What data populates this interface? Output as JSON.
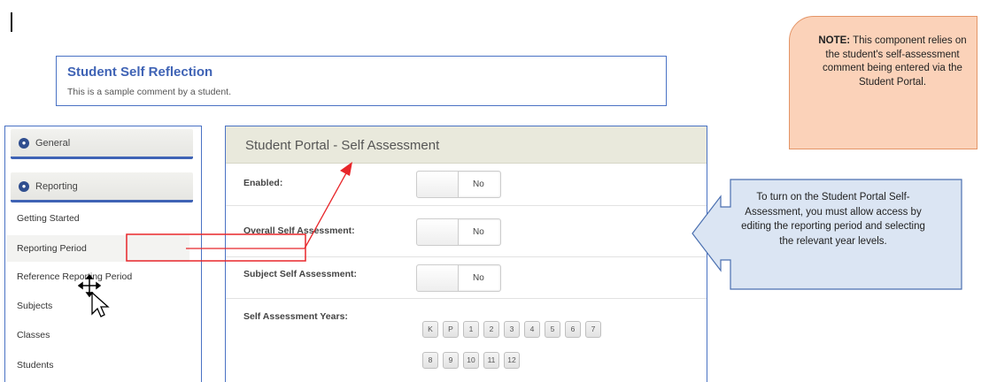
{
  "reflection": {
    "title": "Student Self Reflection",
    "comment": "This is a sample comment by a student."
  },
  "sidebar": {
    "sections": [
      {
        "label": "General"
      },
      {
        "label": "Reporting"
      }
    ],
    "items": [
      {
        "label": "Getting Started"
      },
      {
        "label": "Reporting Period"
      },
      {
        "label": "Reference Reporting Period"
      },
      {
        "label": "Subjects"
      },
      {
        "label": "Classes"
      },
      {
        "label": "Students"
      }
    ]
  },
  "panel": {
    "title": "Student Portal - Self Assessment",
    "rows": [
      {
        "label": "Enabled:",
        "value": "No"
      },
      {
        "label": "Overall Self Assessment:",
        "value": "No"
      },
      {
        "label": "Subject Self Assessment:",
        "value": "No"
      }
    ],
    "years_label": "Self Assessment Years:",
    "years": [
      "K",
      "P",
      "1",
      "2",
      "3",
      "4",
      "5",
      "6",
      "7",
      "8",
      "9",
      "10",
      "11",
      "12"
    ]
  },
  "note": {
    "prefix": "NOTE:",
    "text": " This component relies on the student's self-assessment comment being entered via the Student Portal."
  },
  "callout": {
    "text": "To turn on the Student Portal Self-Assessment, you must allow access by editing the reporting period and selecting the relevant year levels."
  },
  "colors": {
    "accent_blue": "#3f63b5",
    "panel_header": "#e9e9dc",
    "note_fill": "#fbd2b9",
    "callout_fill": "#dbe5f3",
    "annotation_red": "#e8262a"
  },
  "icons": {
    "section_icon": "circle-bullet-icon",
    "cursor": "move-cursor-icon"
  }
}
